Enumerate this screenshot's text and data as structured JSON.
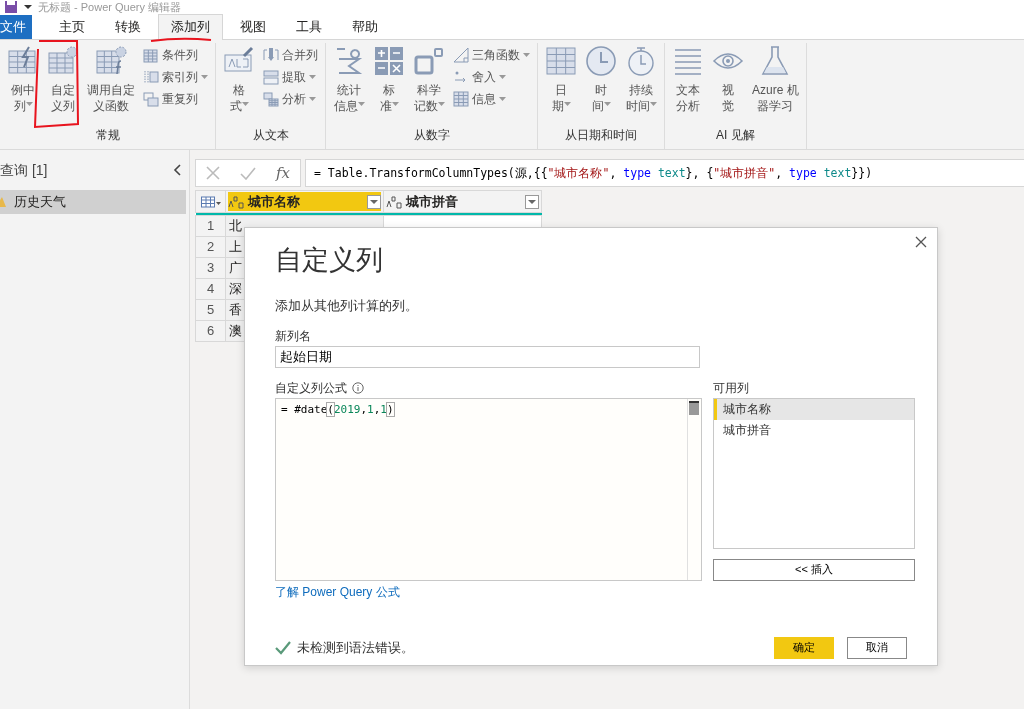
{
  "window": {
    "title": "无标题 - Power Query 编辑器"
  },
  "menu_tabs": [
    {
      "label": "文件",
      "kind": "file",
      "selected": false
    },
    {
      "label": "主页",
      "kind": "tab",
      "selected": false
    },
    {
      "label": "转换",
      "kind": "tab",
      "selected": false
    },
    {
      "label": "添加列",
      "kind": "tab",
      "selected": true
    },
    {
      "label": "视图",
      "kind": "tab",
      "selected": false
    },
    {
      "label": "工具",
      "kind": "tab",
      "selected": false
    },
    {
      "label": "帮助",
      "kind": "tab",
      "selected": false
    }
  ],
  "ribbon_groups": [
    {
      "label": "常规",
      "items": [
        {
          "kind": "large",
          "lines": [
            "例中",
            "列"
          ],
          "dropdown": true
        },
        {
          "kind": "large",
          "lines": [
            "自定",
            "义列"
          ],
          "dropdown": false
        },
        {
          "kind": "large",
          "lines": [
            "调用自定",
            "义函数"
          ],
          "dropdown": false
        },
        {
          "kind": "small",
          "lines": [
            "条件列"
          ],
          "dropdown": false
        },
        {
          "kind": "small",
          "lines": [
            "索引列"
          ],
          "dropdown": true
        },
        {
          "kind": "small",
          "lines": [
            "重复列"
          ],
          "dropdown": false
        }
      ]
    },
    {
      "label": "从文本",
      "items": [
        {
          "kind": "large",
          "lines": [
            "格",
            "式"
          ],
          "dropdown": true
        },
        {
          "kind": "small",
          "lines": [
            "合并列"
          ],
          "dropdown": false
        },
        {
          "kind": "small",
          "lines": [
            "提取"
          ],
          "dropdown": true
        },
        {
          "kind": "small",
          "lines": [
            "分析"
          ],
          "dropdown": true
        }
      ]
    },
    {
      "label": "从数字",
      "items": [
        {
          "kind": "large",
          "lines": [
            "统计",
            "信息"
          ],
          "dropdown": true
        },
        {
          "kind": "large",
          "lines": [
            "标",
            "准"
          ],
          "dropdown": true
        },
        {
          "kind": "large",
          "lines": [
            "科学",
            "记数"
          ],
          "dropdown": true
        },
        {
          "kind": "small",
          "lines": [
            "三角函数"
          ],
          "dropdown": true
        },
        {
          "kind": "small",
          "lines": [
            "舍入"
          ],
          "dropdown": true
        },
        {
          "kind": "small",
          "lines": [
            "信息"
          ],
          "dropdown": true
        }
      ]
    },
    {
      "label": "从日期和时间",
      "items": [
        {
          "kind": "large",
          "lines": [
            "日",
            "期"
          ],
          "dropdown": true
        },
        {
          "kind": "large",
          "lines": [
            "时",
            "间"
          ],
          "dropdown": true
        },
        {
          "kind": "large",
          "lines": [
            "持续",
            "时间"
          ],
          "dropdown": true
        }
      ]
    },
    {
      "label": "AI 见解",
      "items": [
        {
          "kind": "large",
          "lines": [
            "文本",
            "分析"
          ],
          "dropdown": false
        },
        {
          "kind": "large",
          "lines": [
            "视",
            "觉"
          ],
          "dropdown": false
        },
        {
          "kind": "large",
          "lines": [
            "Azure 机",
            "器学习"
          ],
          "dropdown": false
        }
      ]
    }
  ],
  "queries_pane": {
    "title": "查询 [1]",
    "items": [
      {
        "label": "历史天气",
        "selected": true
      }
    ]
  },
  "formula_bar": {
    "fx_label": "fx",
    "tokens": [
      {
        "text": "= Table.TransformColumnTypes(源,{{",
        "kind": "plain"
      },
      {
        "text": "\"城市名称\"",
        "kind": "string"
      },
      {
        "text": ", ",
        "kind": "plain"
      },
      {
        "text": "type",
        "kind": "keyword"
      },
      {
        "text": " text",
        "kind": "type"
      },
      {
        "text": "}, {",
        "kind": "plain"
      },
      {
        "text": "\"城市拼音\"",
        "kind": "string"
      },
      {
        "text": ", ",
        "kind": "plain"
      },
      {
        "text": "type",
        "kind": "keyword"
      },
      {
        "text": " text",
        "kind": "type"
      },
      {
        "text": "}})",
        "kind": "plain"
      }
    ]
  },
  "table": {
    "columns": [
      {
        "label": "城市名称",
        "selected": true
      },
      {
        "label": "城市拼音",
        "selected": false
      }
    ],
    "rows": [
      {
        "index": "1",
        "cell": "北"
      },
      {
        "index": "2",
        "cell": "上"
      },
      {
        "index": "3",
        "cell": "广"
      },
      {
        "index": "4",
        "cell": "深"
      },
      {
        "index": "5",
        "cell": "香"
      },
      {
        "index": "6",
        "cell": "澳"
      }
    ]
  },
  "dialog": {
    "title": "自定义列",
    "subtitle": "添加从其他列计算的列。",
    "name_label": "新列名",
    "name_value": "起始日期",
    "formula_label": "自定义列公式",
    "formula_tokens": [
      {
        "text": "= #date",
        "kind": "plain"
      },
      {
        "text": "(",
        "kind": "bracket"
      },
      {
        "text": "2019",
        "kind": "number"
      },
      {
        "text": ",",
        "kind": "plain"
      },
      {
        "text": "1",
        "kind": "number"
      },
      {
        "text": ",",
        "kind": "plain"
      },
      {
        "text": "1",
        "kind": "number"
      },
      {
        "text": ")",
        "kind": "bracket"
      }
    ],
    "columns_label": "可用列",
    "available_columns": [
      {
        "label": "城市名称",
        "selected": true
      },
      {
        "label": "城市拼音",
        "selected": false
      }
    ],
    "insert_button": "<< 插入",
    "help_link": "了解 Power Query 公式",
    "status": "未检测到语法错误。",
    "ok_button": "确定",
    "cancel_button": "取消"
  }
}
